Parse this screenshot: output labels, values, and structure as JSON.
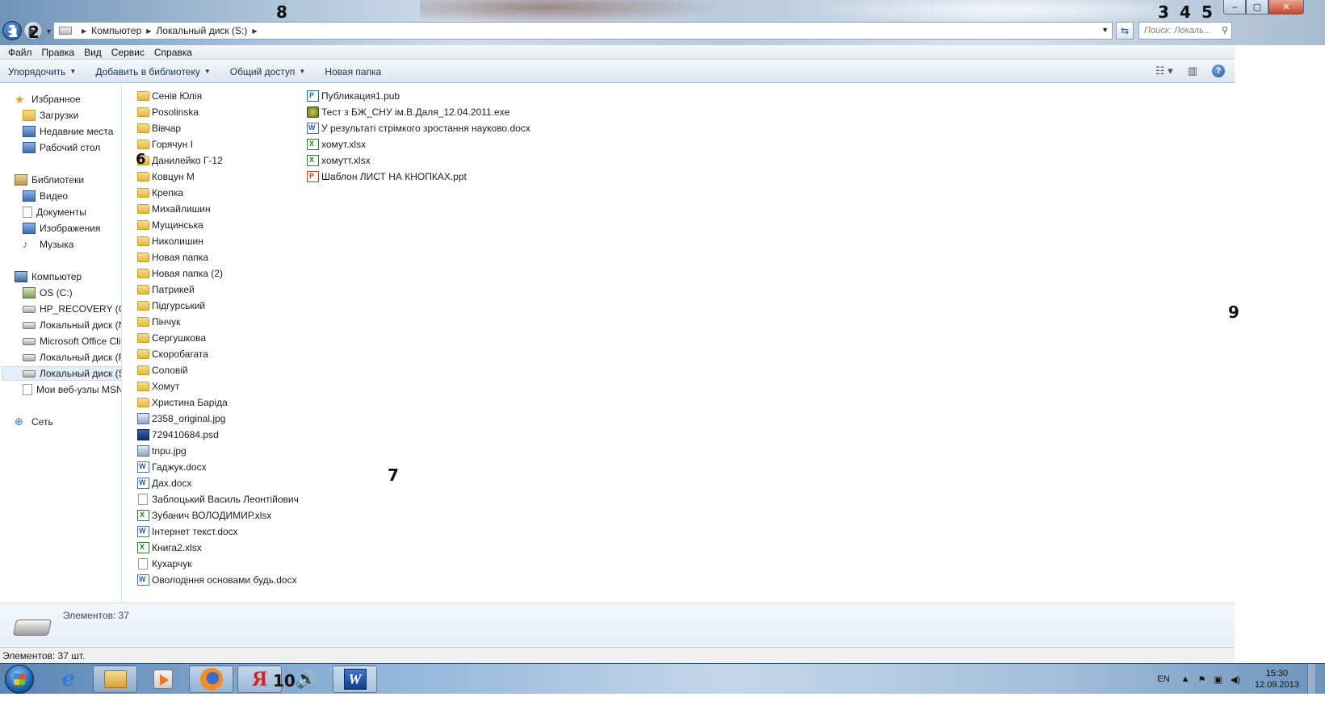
{
  "window": {
    "controls": {
      "minimize": "–",
      "maximize": "▢",
      "close": "✕"
    }
  },
  "annotations": [
    "1",
    "2",
    "3",
    "4",
    "5",
    "6",
    "7",
    "8",
    "9",
    "10"
  ],
  "address_bar": {
    "crumbs": [
      "Компьютер",
      "Локальный диск (S:)"
    ],
    "search_placeholder": "Поиск: Локаль..."
  },
  "menu": [
    "Файл",
    "Правка",
    "Вид",
    "Сервис",
    "Справка"
  ],
  "commands": {
    "organize": "Упорядочить",
    "add_to_library": "Добавить в библиотеку",
    "share": "Общий доступ",
    "new_folder": "Новая папка",
    "help": "?"
  },
  "navigation": {
    "favorites": "Избранное",
    "downloads": "Загрузки",
    "recent": "Недавние места",
    "desktop": "Рабочий стол",
    "libraries": "Библиотеки",
    "video": "Видео",
    "documents": "Документы",
    "images": "Изображения",
    "music": "Музыка",
    "computer": "Компьютер",
    "os": "OS (C:)",
    "hp_recovery": "HP_RECOVERY (G:)",
    "local_n": "Локальный диск (N",
    "office_click": "Microsoft Office Clic",
    "local_r": "Локальный диск (R",
    "local_s": "Локальный диск (S:",
    "msn": "Мои веб-узлы MSN",
    "network": "Сеть"
  },
  "files": [
    {
      "name": "Сенів Юлія",
      "type": "folder"
    },
    {
      "name": "Posolinska",
      "type": "folder"
    },
    {
      "name": "Вівчар",
      "type": "folder"
    },
    {
      "name": "Горячун І",
      "type": "folder"
    },
    {
      "name": "Данилейко Г-12",
      "type": "folder"
    },
    {
      "name": "Ковцун М",
      "type": "folder"
    },
    {
      "name": "Крепка",
      "type": "folder"
    },
    {
      "name": "Михайлишин",
      "type": "folder"
    },
    {
      "name": "Мущинська",
      "type": "folder"
    },
    {
      "name": "Николишин",
      "type": "folder"
    },
    {
      "name": "Новая папка",
      "type": "folder"
    },
    {
      "name": "Новая папка (2)",
      "type": "folder"
    },
    {
      "name": "Патрикей",
      "type": "folder"
    },
    {
      "name": "Підгурський",
      "type": "folder"
    },
    {
      "name": "Пінчук",
      "type": "folder"
    },
    {
      "name": "Сергушкова",
      "type": "folder"
    },
    {
      "name": "Скоробагата",
      "type": "folder"
    },
    {
      "name": "Соловій",
      "type": "folder"
    },
    {
      "name": "Хомут",
      "type": "folder"
    },
    {
      "name": "Христина Баріда",
      "type": "folder"
    },
    {
      "name": "2358_original.jpg",
      "type": "jpg"
    },
    {
      "name": "729410684.psd",
      "type": "psd"
    },
    {
      "name": "tnpu.jpg",
      "type": "jpg"
    },
    {
      "name": "Гаджук.docx",
      "type": "docx"
    },
    {
      "name": "Дах.docx",
      "type": "docx"
    },
    {
      "name": "Заблоцький Василь Леонтійович",
      "type": "blank"
    },
    {
      "name": "Зубанич ВОЛОДИМИР.xlsx",
      "type": "xlsx"
    },
    {
      "name": "Інтернет текст.docx",
      "type": "docx"
    },
    {
      "name": "Книга2.xlsx",
      "type": "xlsx"
    },
    {
      "name": "Кухарчук",
      "type": "blank"
    },
    {
      "name": "Оволодіння основами будь.docx",
      "type": "docx"
    },
    {
      "name": "Публикация1.pub",
      "type": "pub"
    },
    {
      "name": "Тест з БЖ_СНУ ім.В.Даля_12.04.2011.exe",
      "type": "exe"
    },
    {
      "name": "У результаті стрімкого зростання науково.docx",
      "type": "docx"
    },
    {
      "name": "хомут.xlsx",
      "type": "xlsx"
    },
    {
      "name": "хомутт.xlsx",
      "type": "xlsx"
    },
    {
      "name": "Шаблон ЛИСТ НА КНОПКАХ.ppt",
      "type": "ppt"
    }
  ],
  "details": {
    "count": "Элементов: 37"
  },
  "status": {
    "text": "Элементов: 37 шт."
  },
  "taskbar": {
    "lang": "EN",
    "time": "15:30",
    "date": "12.09.2013"
  }
}
